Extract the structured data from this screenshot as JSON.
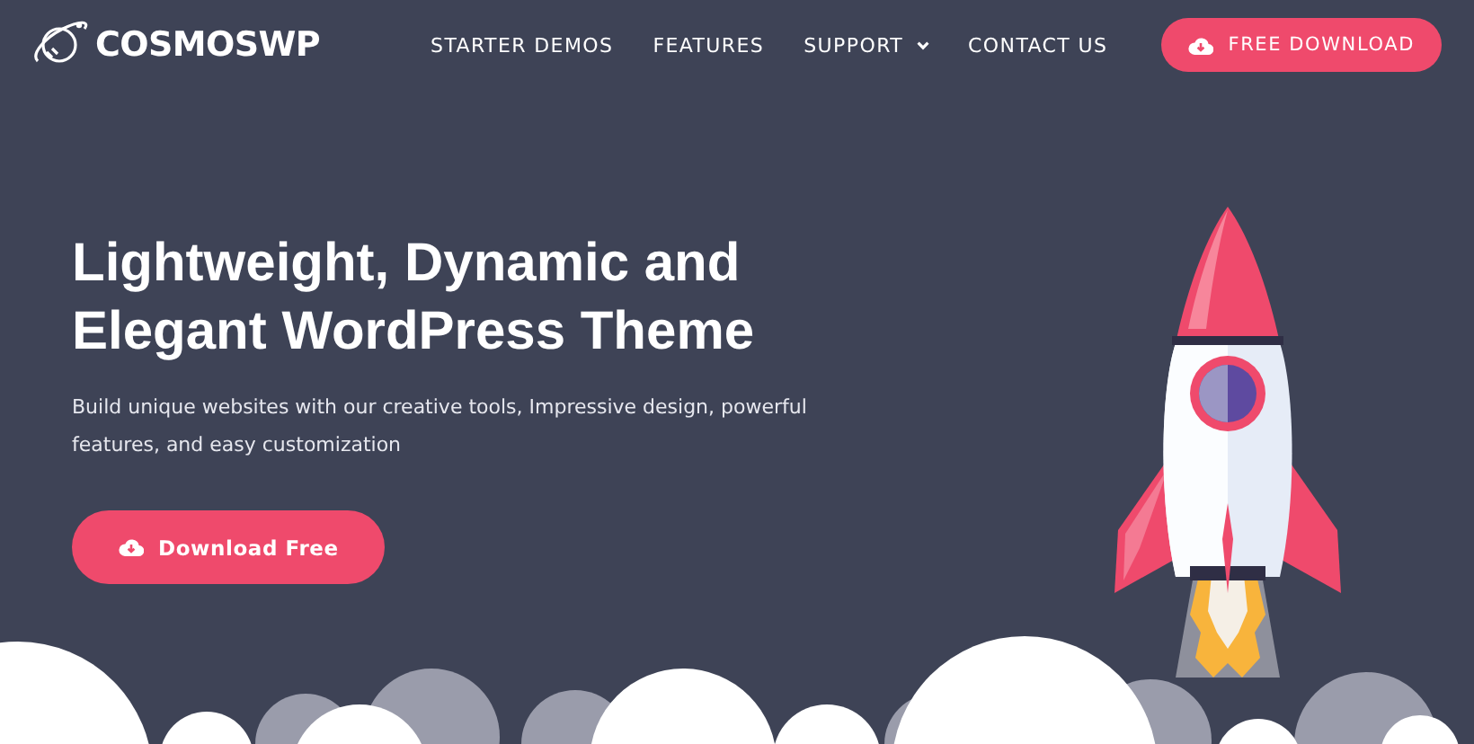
{
  "logo": {
    "text": "COSMOSWP"
  },
  "nav": [
    {
      "label": "STARTER DEMOS",
      "has_dropdown": false
    },
    {
      "label": "FEATURES",
      "has_dropdown": false
    },
    {
      "label": "SUPPORT",
      "has_dropdown": true
    },
    {
      "label": "CONTACT US",
      "has_dropdown": false
    }
  ],
  "header_button": {
    "label": "FREE DOWNLOAD"
  },
  "hero": {
    "title": "Lightweight, Dynamic and Elegant WordPress Theme",
    "description": "Build unique websites with our creative tools, Impressive design, powerful features, and easy customization",
    "button": {
      "label": "Download Free"
    }
  }
}
